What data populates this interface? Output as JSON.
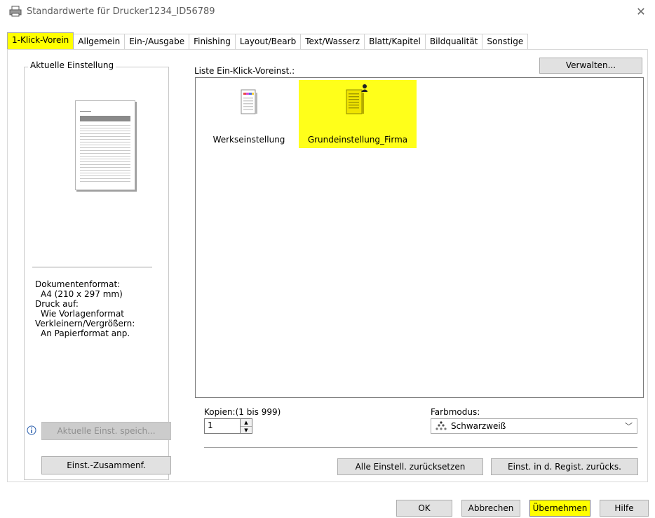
{
  "window": {
    "title": "Standardwerte für Drucker1234_ID56789"
  },
  "tabs": [
    "1-Klick-Vorein",
    "Allgemein",
    "Ein-/Ausgabe",
    "Finishing",
    "Layout/Bearb",
    "Text/Wasserz",
    "Blatt/Kapitel",
    "Bildqualität",
    "Sonstige"
  ],
  "left": {
    "group_label": "Aktuelle Einstellung",
    "info": [
      "Dokumentenformat:",
      "A4 (210 x 297 mm)",
      "Druck auf:",
      "Wie Vorlagenformat",
      "Verkleinern/Vergrößern:",
      "An Papierformat anp."
    ],
    "save_button": "Aktuelle Einst. speich...",
    "summary_button": "Einst.-Zusammenf."
  },
  "list": {
    "label": "Liste Ein-Klick-Voreinst.:",
    "manage_button": "Verwalten...",
    "presets": [
      "Werkseinstellung",
      "Grundeinstellung_Firma"
    ]
  },
  "copies": {
    "label": "Kopien:(1 bis 999)",
    "value": "1"
  },
  "color_mode": {
    "label": "Farbmodus:",
    "value": "Schwarzweiß"
  },
  "buttons": {
    "reset_all": "Alle Einstell. zurücksetzen",
    "reset_registry": "Einst. in d. Regist. zurücks.",
    "ok": "OK",
    "cancel": "Abbrechen",
    "apply": "Übernehmen",
    "help": "Hilfe"
  },
  "colors": {
    "highlight": "#ffff00",
    "button_face": "#e1e1e1"
  }
}
